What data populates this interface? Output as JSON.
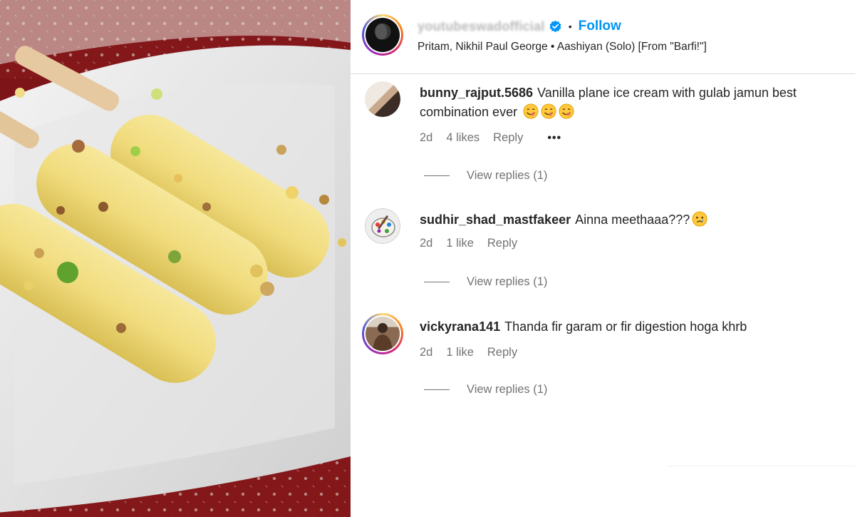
{
  "photo": {
    "icon": "kulfi-photo"
  },
  "header": {
    "username": "youtubeswadofficial",
    "follow_label": "Follow",
    "separator": "•",
    "audio": "Pritam, Nikhil Paul George • Aashiyan (Solo) [From \"Barfi!\"]"
  },
  "comments": [
    {
      "username": "bunny_rajput.5686",
      "text": "Vanilla plane ice cream with gulab jamun best combination ever",
      "emoji_count": 3,
      "time": "2d",
      "likes": "4 likes",
      "reply_label": "Reply",
      "more": "•••",
      "view_replies": "View replies (1)"
    },
    {
      "username": "sudhir_shad_mastfakeer",
      "text": "Ainna meethaaa???",
      "time": "2d",
      "likes": "1 like",
      "reply_label": "Reply",
      "view_replies": "View replies (1)"
    },
    {
      "username": "vickyrana141",
      "text": "Thanda fir garam or fir digestion hoga khrb",
      "time": "2d",
      "likes": "1 like",
      "reply_label": "Reply",
      "view_replies": "View replies (1)"
    }
  ],
  "colors": {
    "link": "#0095f6",
    "muted": "#737373",
    "text": "#262626"
  }
}
